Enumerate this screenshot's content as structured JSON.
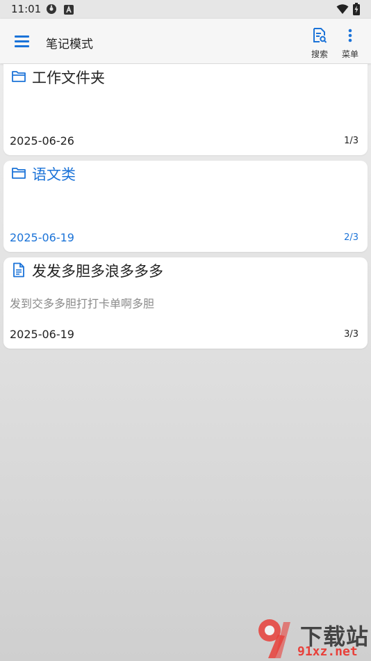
{
  "status_bar": {
    "time": "11:01",
    "left_icons": [
      "settings-gear-icon",
      "a-box-icon"
    ],
    "right_icons": [
      "wifi-icon",
      "battery-charging-icon"
    ]
  },
  "app_bar": {
    "menu_icon": "hamburger-menu-icon",
    "title": "笔记模式",
    "actions": [
      {
        "icon": "document-search-icon",
        "label": "搜索"
      },
      {
        "icon": "more-vertical-icon",
        "label": "菜单"
      }
    ]
  },
  "notes": [
    {
      "type": "folder",
      "icon": "folder-icon",
      "title": "工作文件夹",
      "preview": "",
      "date": "2025-06-26",
      "index": "1/3"
    },
    {
      "type": "folder",
      "icon": "folder-icon",
      "title": "语文类",
      "preview": "",
      "date": "2025-06-19",
      "index": "2/3"
    },
    {
      "type": "note",
      "icon": "document-icon",
      "title": "发发多胆多浪多多多",
      "preview": "发到交多多胆打打卡单啊多胆",
      "date": "2025-06-19",
      "index": "3/3"
    }
  ],
  "colors": {
    "accent": "#1b73d8",
    "text": "#222222",
    "muted": "#8a8a8a",
    "watermark_red": "#e8403a"
  },
  "watermark": {
    "top_text": "下载站",
    "bottom_text": "91xz.net"
  }
}
